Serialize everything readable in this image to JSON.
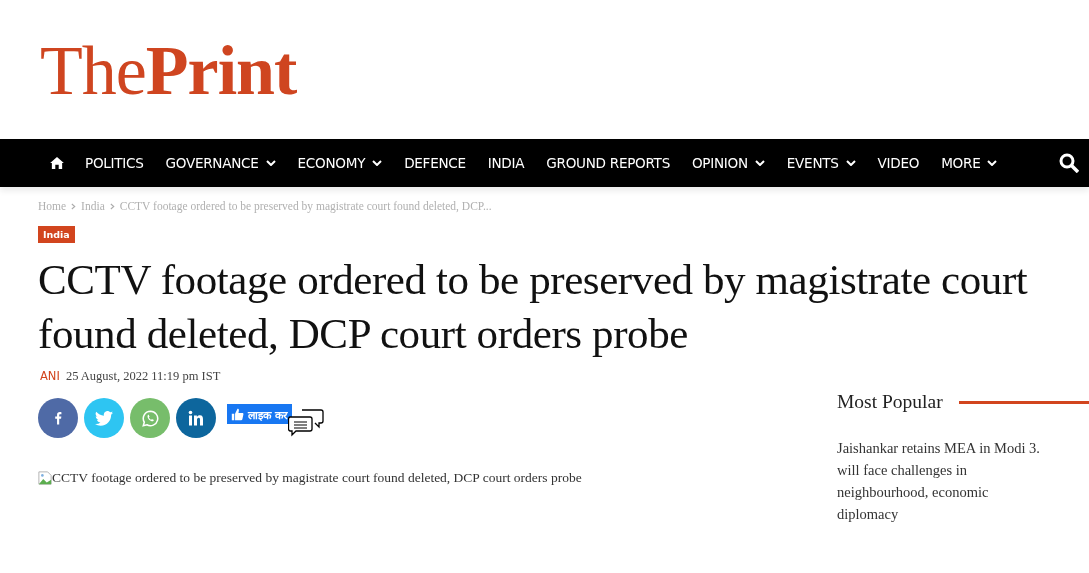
{
  "logo": "The**Print**",
  "nav": {
    "items": [
      {
        "label": "POLITICS",
        "has_dropdown": false
      },
      {
        "label": "GOVERNANCE",
        "has_dropdown": true
      },
      {
        "label": "ECONOMY",
        "has_dropdown": true
      },
      {
        "label": "DEFENCE",
        "has_dropdown": false
      },
      {
        "label": "INDIA",
        "has_dropdown": false
      },
      {
        "label": "GROUND REPORTS",
        "has_dropdown": false
      },
      {
        "label": "OPINION",
        "has_dropdown": true
      },
      {
        "label": "EVENTS",
        "has_dropdown": true
      },
      {
        "label": "VIDEO",
        "has_dropdown": false
      },
      {
        "label": "MORE",
        "has_dropdown": true
      }
    ]
  },
  "breadcrumb": [
    "Home",
    "India",
    "CCTV footage ordered to be preserved by magistrate court found deleted, DCP..."
  ],
  "category": "India",
  "headline": "CCTV footage ordered to be preserved by magistrate court found deleted, DCP court orders probe",
  "author": "ANI",
  "date": "25 August, 2022 11:19 pm IST",
  "share": [
    {
      "kind": "facebook",
      "color": "#4f6aa6"
    },
    {
      "kind": "twitter",
      "color": "#2ec5f2"
    },
    {
      "kind": "whatsapp",
      "color": "#77bd6b"
    },
    {
      "kind": "linkedin",
      "color": "#0d669d"
    }
  ],
  "like_button": "लाइक कर",
  "image_alt": "CCTV footage ordered to be preserved by magistrate court found deleted, DCP court orders probe",
  "most_popular": {
    "title": "Most Popular",
    "items": [
      "Jaishankar retains MEA in Modi 3. will face challenges in neighbourhood, economic diplomacy"
    ]
  }
}
